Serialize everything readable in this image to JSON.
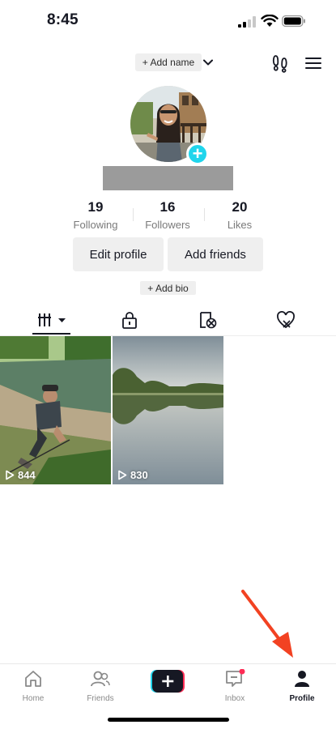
{
  "status_bar": {
    "time": "8:45"
  },
  "header": {
    "add_name": "+ Add name"
  },
  "stats": [
    {
      "value": "19",
      "label": "Following"
    },
    {
      "value": "16",
      "label": "Followers"
    },
    {
      "value": "20",
      "label": "Likes"
    }
  ],
  "buttons": {
    "edit_profile": "Edit profile",
    "add_friends": "Add friends",
    "add_bio": "+ Add bio"
  },
  "videos": [
    {
      "views": "844"
    },
    {
      "views": "830"
    }
  ],
  "nav": {
    "home": "Home",
    "friends": "Friends",
    "inbox": "Inbox",
    "profile": "Profile"
  },
  "colors": {
    "accent_cyan": "#20d5ec",
    "accent_red": "#fe2c55",
    "annotation_arrow": "#f24222"
  },
  "icons": [
    "signal-icon",
    "wifi-icon",
    "battery-icon",
    "chevron-down-icon",
    "footprints-icon",
    "menu-icon",
    "grid-icon",
    "lock-icon",
    "repost-icon",
    "liked-icon",
    "home-icon",
    "friends-icon",
    "create-icon",
    "inbox-icon",
    "profile-icon",
    "play-icon"
  ]
}
